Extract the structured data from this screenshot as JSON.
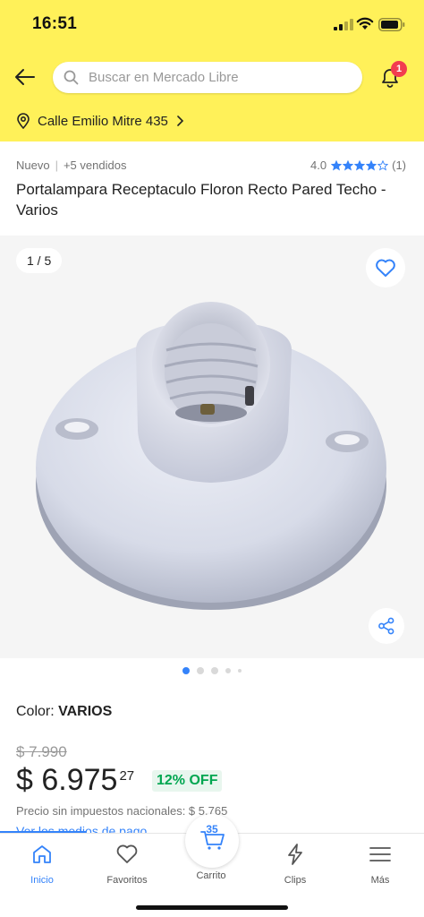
{
  "status_bar": {
    "time": "16:51"
  },
  "header": {
    "search_placeholder": "Buscar en Mercado Libre",
    "notifications_count": "1",
    "location": "Calle Emilio Mitre 435"
  },
  "product": {
    "condition": "Nuevo",
    "sold": "+5 vendidos",
    "rating_value": "4.0",
    "rating_stars": 4,
    "rating_count": "(1)",
    "title": "Portalampara Receptaculo Floron Recto Pared Techo - Varios",
    "gallery_counter": "1 / 5",
    "color_label": "Color: ",
    "color_value": "VARIOS",
    "old_price": "$ 7.990",
    "price_main": "$ 6.975",
    "price_cents": "27",
    "discount": "12% OFF",
    "tax_note": "Precio sin impuestos nacionales: $ 5.765",
    "payment_link": "Ver los medios de pago"
  },
  "bottom_nav": {
    "items": [
      {
        "label": "Inicio",
        "icon": "home-icon",
        "active": true
      },
      {
        "label": "Favoritos",
        "icon": "heart-icon",
        "active": false
      },
      {
        "label": "Carrito",
        "icon": "cart-icon",
        "active": false
      },
      {
        "label": "Clips",
        "icon": "clips-icon",
        "active": false
      },
      {
        "label": "Más",
        "icon": "menu-icon",
        "active": false
      }
    ],
    "cart_count": "35"
  },
  "colors": {
    "brand_yellow": "#fff159",
    "accent_blue": "#3483fa",
    "discount_green": "#00a650",
    "badge_red": "#f23d4f"
  }
}
